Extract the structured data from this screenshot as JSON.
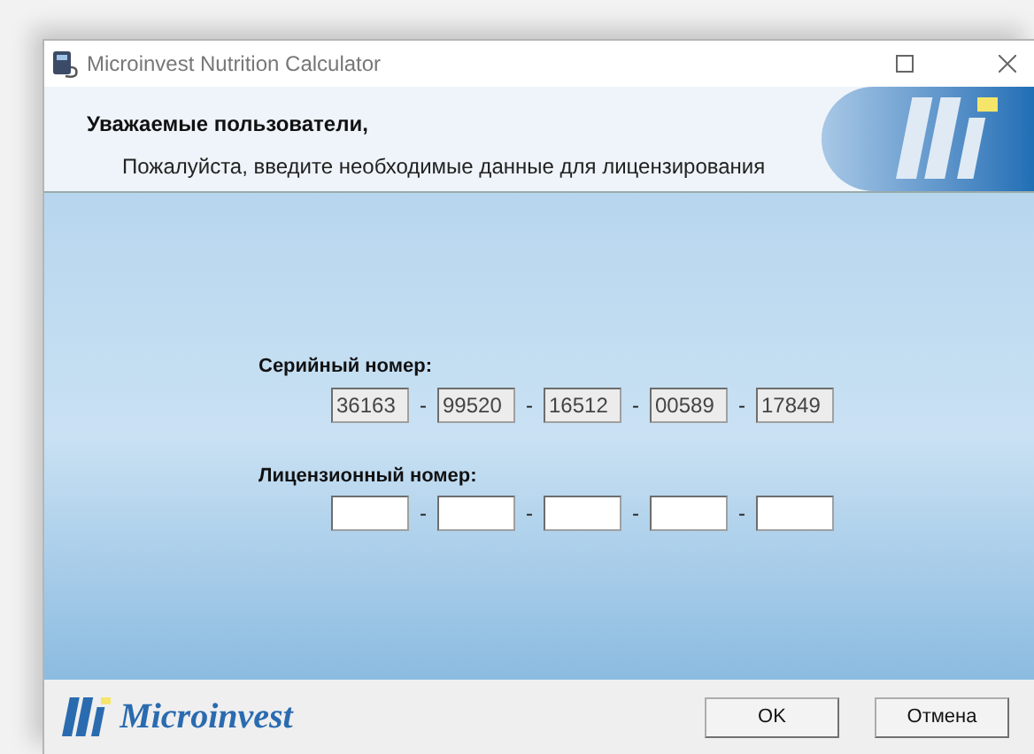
{
  "window": {
    "title": "Microinvest Nutrition Calculator"
  },
  "header": {
    "greeting": "Уважаемые пользователи,",
    "instruction": "Пожалуйста, введите необходимые данные для лицензирования"
  },
  "serial": {
    "label": "Серийный номер:",
    "separator": "-",
    "parts": [
      {
        "value": "36163",
        "disabled": true
      },
      {
        "value": "99520",
        "disabled": true
      },
      {
        "value": "16512",
        "disabled": true
      },
      {
        "value": "00589",
        "disabled": true
      },
      {
        "value": "17849",
        "disabled": true
      }
    ]
  },
  "license": {
    "label": "Лицензионный номер:",
    "separator": "-",
    "parts": [
      {
        "disabled": false
      },
      {
        "disabled": false
      },
      {
        "disabled": false
      },
      {
        "disabled": false
      },
      {
        "disabled": false
      }
    ]
  },
  "footer": {
    "brand": "Microinvest",
    "buttons": [
      "OK",
      "Отмена"
    ]
  }
}
